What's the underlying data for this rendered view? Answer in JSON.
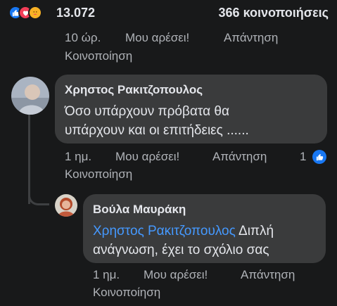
{
  "reactions": {
    "icons": [
      "like-icon",
      "love-icon",
      "care-icon"
    ],
    "colors": {
      "like": "#1877f2",
      "love": "#f33e58",
      "care": "#f7b125"
    },
    "count": "13.072",
    "shares": "366 κοινοποιήσεις"
  },
  "prev_comment_actions": {
    "time": "10 ώρ.",
    "like": "Μου αρέσει!",
    "reply": "Απάντηση",
    "share": "Κοινοποίηση"
  },
  "comments": [
    {
      "author": "Χρηστος Ρακιτζοπουλος",
      "text_line1": "Όσο υπάρχουν πρόβατα θα",
      "text_line2": "υπάρχουν και  οι επιτήδειες ......",
      "time": "1 ημ.",
      "like": "Μου αρέσει!",
      "reply": "Απάντηση",
      "share": "Κοινοποίηση",
      "reaction_count": "1"
    },
    {
      "author": "Βούλα Μαυράκη",
      "mention": "Χρηστος Ρακιτζοπουλος",
      "text_after_mention": " Διπλή",
      "text_line2": "ανάγνωση, έχει το σχόλιο σας",
      "time": "1 ημ.",
      "like": "Μου αρέσει!",
      "reply": "Απάντηση",
      "share": "Κοινοποίηση"
    }
  ]
}
